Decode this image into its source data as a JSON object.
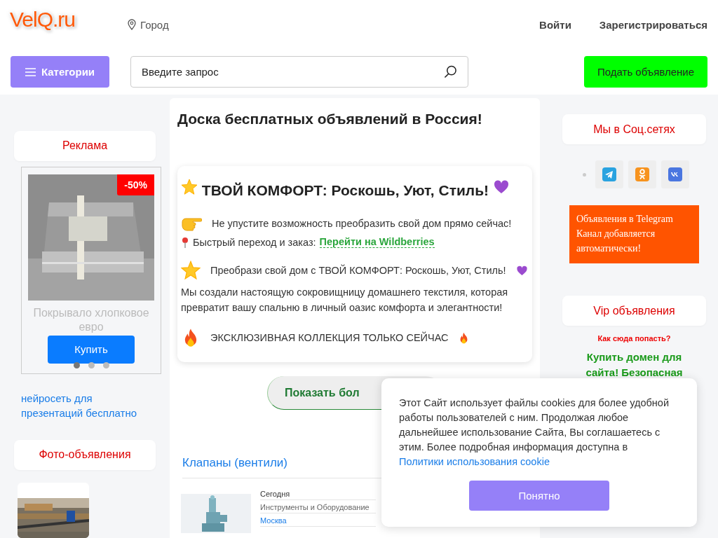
{
  "header": {
    "logo": "VelQ.ru",
    "city": "Город",
    "login": "Войти",
    "register": "Зарегистрироваться",
    "categories": "Категории",
    "search": {
      "placeholder": "Введите запрос"
    },
    "post_ad": "Подать объявление"
  },
  "left": {
    "ads_title": "Реклама",
    "ad": {
      "badge": "-50%",
      "title": "Покрывало хлопковое евро",
      "buy": "Купить",
      "dots": [
        {
          "selected": true
        },
        {
          "selected": false
        },
        {
          "selected": false
        }
      ]
    },
    "link": "нейросеть для презентаций бесплатно",
    "photo_title": "Фото-объявления"
  },
  "center": {
    "title": "Доска бесплатных объявлений в Россия!",
    "promo": {
      "heading": "ТВОЙ КОМФОРТ: Роскошь, Уют, Стиль!",
      "offer": "Не упустите возможность преобразить свой дом прямо сейчас!",
      "order": "Быстрый переход и заказ:",
      "order_link": "Перейти на Wildberries",
      "transform": "Преобрази свой дом с ТВОЙ КОМФОРТ: Роскошь, Уют, Стиль!",
      "description": "Мы создали настоящую сокровищницу домашнего текстиля, которая превратит вашу спальню в личный оазис комфорта и элегантности!",
      "exclusive": "ЭКСКЛЮЗИВНАЯ КОЛЛЕКЦИЯ ТОЛЬКО СЕЙЧАС"
    },
    "show_more": "Показать бол",
    "listing": {
      "title": "Клапаны (вентили)",
      "date": "Сегодня",
      "category": "Инструменты и Оборудование",
      "city": "Москва"
    }
  },
  "right": {
    "social_title": "Мы в Соц.сетях",
    "telegram_box": [
      "Объявления в Telegram",
      "Канал добавляется",
      "автоматически!"
    ],
    "vip_title": "Vip объявления",
    "vip_how": "Как сюда попасть?",
    "vip_offer": "Купить домен для сайта! Безопасная"
  },
  "cookie": {
    "text": "Этот Сайт использует файлы cookies для более удобной работы пользователей с ним. Продолжая любое дальнейшее использование Сайта, Вы соглашаетесь с этим. Более подробная информация доступна в",
    "link": "Политики использования cookie",
    "button": "Понятно"
  }
}
